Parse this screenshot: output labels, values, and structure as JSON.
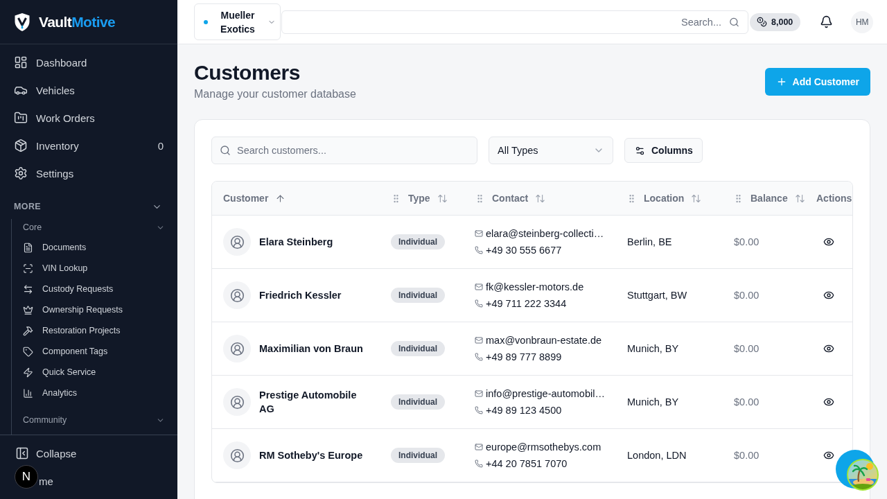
{
  "sidebar": {
    "brand": {
      "first": "Vault",
      "second": "Motive"
    },
    "nav_items": [
      {
        "label": "Dashboard"
      },
      {
        "label": "Vehicles"
      },
      {
        "label": "Work Orders"
      },
      {
        "label": "Inventory",
        "count": "0"
      },
      {
        "label": "Settings"
      }
    ],
    "more": {
      "title": "MORE",
      "groups": [
        {
          "title": "Core",
          "items": [
            {
              "label": "Documents"
            },
            {
              "label": "VIN Lookup"
            },
            {
              "label": "Custody Requests"
            },
            {
              "label": "Ownership Requests"
            },
            {
              "label": "Restoration Projects"
            },
            {
              "label": "Component Tags"
            },
            {
              "label": "Quick Service"
            },
            {
              "label": "Analytics"
            }
          ]
        },
        {
          "title": "Community"
        }
      ]
    },
    "footer": [
      {
        "label": "Collapse"
      },
      {
        "label": "me"
      }
    ]
  },
  "dev_badge": {
    "label": "N"
  },
  "topbar": {
    "workspace": {
      "name": "Mueller Exotics"
    },
    "search": {
      "placeholder": "Search..."
    },
    "credits": "8,000",
    "avatar_initials": "HM"
  },
  "page": {
    "title": "Customers",
    "subtitle": "Manage your customer database",
    "add_button": "Add Customer"
  },
  "filters": {
    "search": {
      "placeholder": "Search customers..."
    },
    "type_select": {
      "value": "All Types"
    },
    "columns_button": "Columns"
  },
  "table": {
    "columns": [
      {
        "label": "Customer",
        "draggable": false,
        "sortable": true,
        "sorted": true
      },
      {
        "label": "Type",
        "draggable": true,
        "sortable": true,
        "sorted": false
      },
      {
        "label": "Contact",
        "draggable": true,
        "sortable": true,
        "sorted": false
      },
      {
        "label": "Location",
        "draggable": true,
        "sortable": true,
        "sorted": false
      },
      {
        "label": "Balance",
        "draggable": true,
        "sortable": true,
        "sorted": false
      },
      {
        "label": "Actions",
        "draggable": false,
        "sortable": false
      }
    ],
    "rows": [
      {
        "name": "Elara Steinberg",
        "type": "Individual",
        "email": "elara@steinberg-collecti…",
        "phone": "+49 30 555 6677",
        "location": "Berlin, BE",
        "balance": "$0.00"
      },
      {
        "name": "Friedrich Kessler",
        "type": "Individual",
        "email": "fk@kessler-motors.de",
        "phone": "+49 711 222 3344",
        "location": "Stuttgart, BW",
        "balance": "$0.00"
      },
      {
        "name": "Maximilian von Braun",
        "type": "Individual",
        "email": "max@vonbraun-estate.de",
        "phone": "+49 89 777 8899",
        "location": "Munich, BY",
        "balance": "$0.00"
      },
      {
        "name": "Prestige Automobile AG",
        "type": "Individual",
        "email": "info@prestige-automobil…",
        "phone": "+49 89 123 4500",
        "location": "Munich, BY",
        "balance": "$0.00"
      },
      {
        "name": "RM Sotheby's Europe",
        "type": "Individual",
        "email": "europe@rmsothebys.com",
        "phone": "+44 20 7851 7070",
        "location": "London, LDN",
        "balance": "$0.00"
      }
    ]
  }
}
